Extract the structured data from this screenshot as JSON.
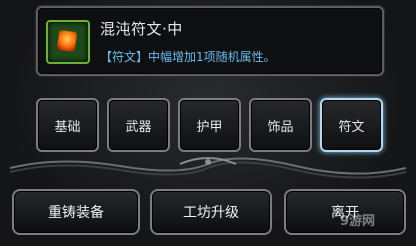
{
  "item": {
    "name": "混沌符文·中",
    "description": "【符文】中幅增加1项随机属性。",
    "icon": "fire-rune-icon"
  },
  "tabs": [
    {
      "label": "基础",
      "active": false
    },
    {
      "label": "武器",
      "active": false
    },
    {
      "label": "护甲",
      "active": false
    },
    {
      "label": "饰品",
      "active": false
    },
    {
      "label": "符文",
      "active": true
    }
  ],
  "actions": {
    "recast": "重铸装备",
    "upgrade": "工坊升级",
    "leave": "离开"
  },
  "watermark": "9游网",
  "colors": {
    "accent_active": "#b7d9ef",
    "description": "#63bff0",
    "icon_border": "#6fae3a"
  }
}
